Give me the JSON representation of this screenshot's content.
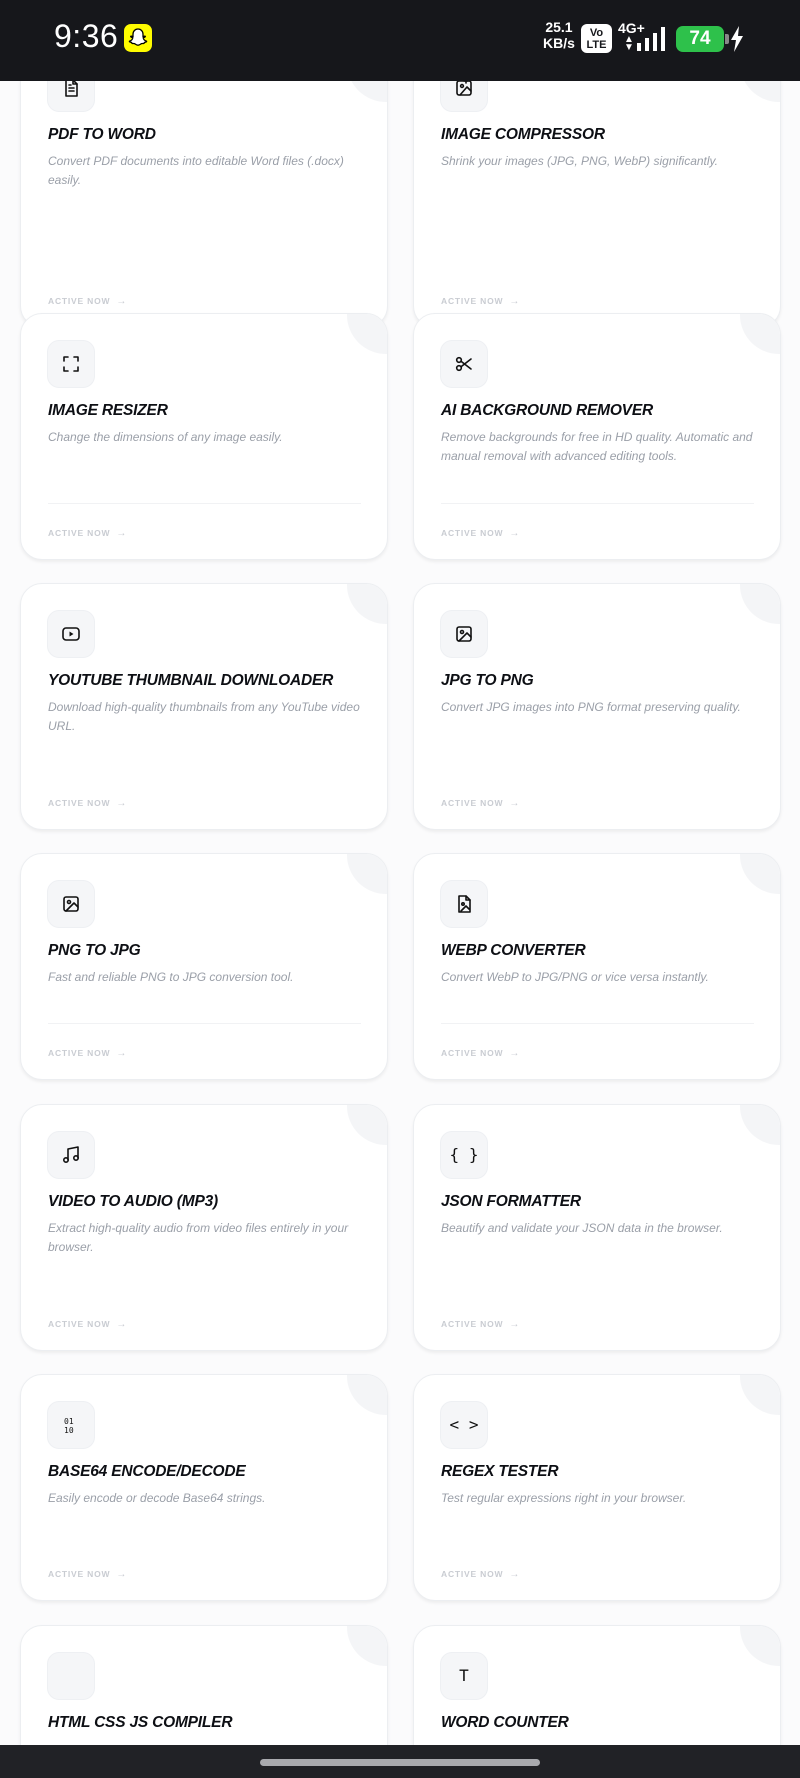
{
  "status_bar": {
    "time": "9:36",
    "speed_value": "25.1",
    "speed_unit": "KB/s",
    "volte_top": "Vo",
    "volte_bottom": "LTE",
    "network": "4G+",
    "battery": "74"
  },
  "cta_label": "ACTIVE NOW",
  "tools": [
    {
      "title": "PDF TO WORD",
      "description": "Convert PDF documents into editable Word files (.docx) easily.",
      "icon": "file-text-icon"
    },
    {
      "title": "IMAGE COMPRESSOR",
      "description": "Shrink your images (JPG, PNG, WebP) significantly.",
      "icon": "image-compress-icon"
    },
    {
      "title": "IMAGE RESIZER",
      "description": "Change the dimensions of any image easily.",
      "icon": "resize-frame-icon"
    },
    {
      "title": "AI BACKGROUND REMOVER",
      "description": "Remove backgrounds for free in HD quality. Automatic and manual removal with advanced editing tools.",
      "icon": "scissors-icon"
    },
    {
      "title": "YOUTUBE THUMBNAIL DOWNLOADER",
      "description": "Download high-quality thumbnails from any YouTube video URL.",
      "icon": "youtube-icon"
    },
    {
      "title": "JPG TO PNG",
      "description": "Convert JPG images into PNG format preserving quality.",
      "icon": "image-icon"
    },
    {
      "title": "PNG TO JPG",
      "description": "Fast and reliable PNG to JPG conversion tool.",
      "icon": "image-icon"
    },
    {
      "title": "WEBP CONVERTER",
      "description": "Convert WebP to JPG/PNG or vice versa instantly.",
      "icon": "file-image-icon"
    },
    {
      "title": "VIDEO TO AUDIO (MP3)",
      "description": "Extract high-quality audio from video files entirely in your browser.",
      "icon": "music-note-icon"
    },
    {
      "title": "JSON FORMATTER",
      "description": "Beautify and validate your JSON data in the browser.",
      "icon": "braces-icon",
      "glyph": "{ }"
    },
    {
      "title": "BASE64 ENCODE/DECODE",
      "description": "Easily encode or decode Base64 strings.",
      "icon": "binary-icon"
    },
    {
      "title": "REGEX TESTER",
      "description": "Test regular expressions right in your browser.",
      "icon": "code-icon",
      "glyph": "< >"
    },
    {
      "title": "HTML CSS JS COMPILER",
      "description": "",
      "icon": "blank-icon"
    },
    {
      "title": "WORD COUNTER",
      "description": "",
      "icon": "text-icon",
      "glyph": "T"
    }
  ]
}
